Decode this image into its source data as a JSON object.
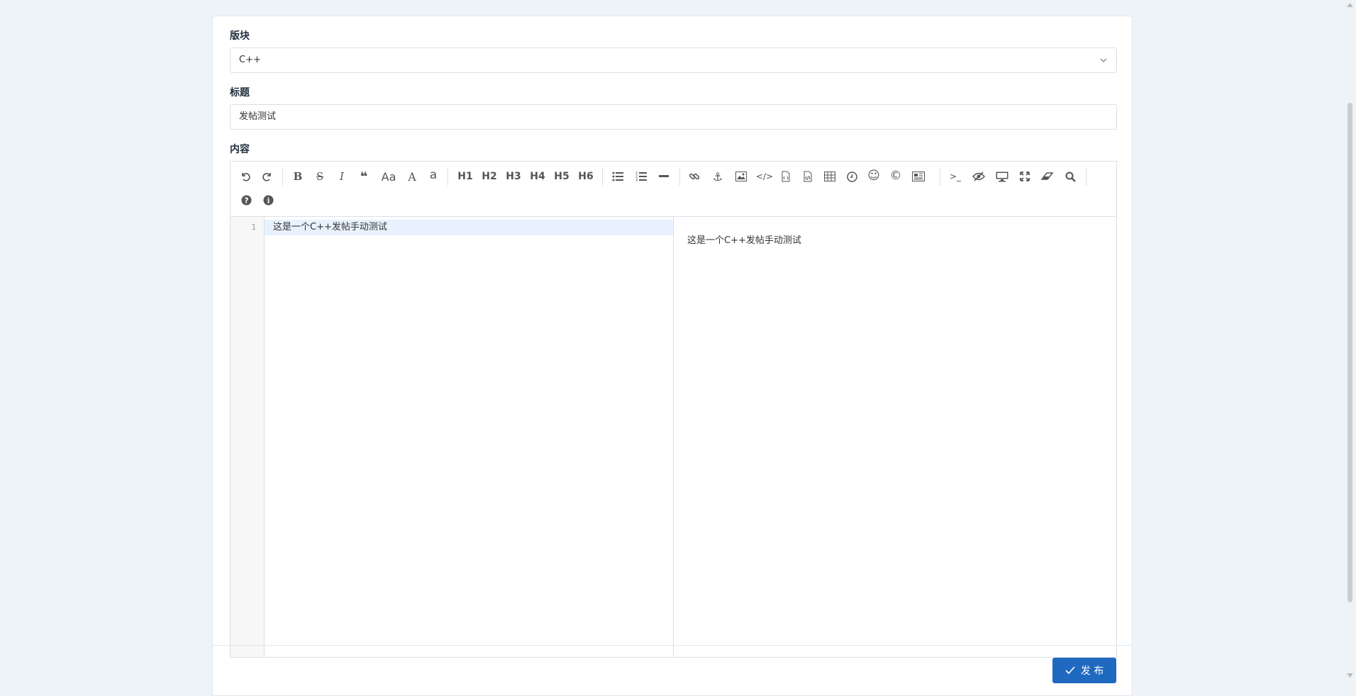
{
  "form": {
    "board_label": "版块",
    "board_value": "C++",
    "title_label": "标题",
    "title_value": "发帖测试",
    "content_label": "内容"
  },
  "editor": {
    "toolbar_row1": [
      {
        "name": "undo-icon"
      },
      {
        "name": "redo-icon"
      },
      {
        "name": "bold-icon",
        "text": "B"
      },
      {
        "name": "strikethrough-icon",
        "text": "S"
      },
      {
        "name": "italic-icon",
        "text": "I"
      },
      {
        "name": "quote-icon",
        "text": "❝"
      },
      {
        "name": "uppercase-icon",
        "text": "Aa"
      },
      {
        "name": "uppercase-first-icon",
        "text": "A"
      },
      {
        "name": "lowercase-icon",
        "text": "a"
      },
      {
        "name": "h1-button",
        "text": "H1"
      },
      {
        "name": "h2-button",
        "text": "H2"
      },
      {
        "name": "h3-button",
        "text": "H3"
      },
      {
        "name": "h4-button",
        "text": "H4"
      },
      {
        "name": "h5-button",
        "text": "H5"
      },
      {
        "name": "h6-button",
        "text": "H6"
      },
      {
        "name": "unordered-list-icon"
      },
      {
        "name": "ordered-list-icon"
      },
      {
        "name": "horizontal-rule-icon"
      },
      {
        "name": "link-icon"
      },
      {
        "name": "anchor-icon",
        "text": "⚓"
      },
      {
        "name": "image-icon"
      },
      {
        "name": "code-icon",
        "text": "</>"
      },
      {
        "name": "preformatted-text-icon"
      },
      {
        "name": "code-block-icon"
      },
      {
        "name": "table-icon"
      },
      {
        "name": "datetime-icon"
      },
      {
        "name": "emoji-icon",
        "text": "☺"
      },
      {
        "name": "html-entities-icon",
        "text": "©"
      },
      {
        "name": "pagebreak-icon"
      },
      {
        "name": "watch-toggle-icon",
        "text": ">_"
      },
      {
        "name": "unwatch-icon"
      },
      {
        "name": "preview-icon"
      },
      {
        "name": "fullscreen-icon"
      },
      {
        "name": "clear-icon"
      },
      {
        "name": "search-icon"
      }
    ],
    "toolbar_row2": [
      {
        "name": "help-icon",
        "text": "?"
      },
      {
        "name": "info-icon",
        "text": "i"
      }
    ],
    "line_number": "1",
    "code_line": "这是一个C++发帖手动测试",
    "preview_text": "这是一个C++发帖手动测试"
  },
  "actions": {
    "publish_label": "发 布"
  },
  "colors": {
    "primary": "#2069c0",
    "background": "#eef3f7",
    "active_line": "#e8f2fe"
  }
}
